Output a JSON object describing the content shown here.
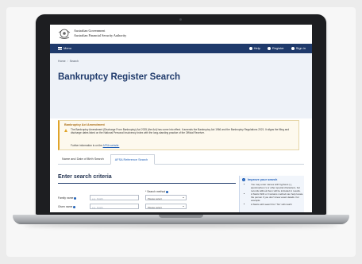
{
  "gov": {
    "line1": "Australian Government",
    "line2": "Australian Financial Security Authority"
  },
  "nav": {
    "menu_label": "Menu",
    "help_label": "Help",
    "register_label": "Register",
    "signin_label": "Sign in"
  },
  "breadcrumb": {
    "home": "Home",
    "current": "Search"
  },
  "page_title": "Bankruptcy Register Search",
  "notice": {
    "title": "Bankruptcy Act Amendment",
    "body": "The Bankruptcy Amendment (Discharge From Bankruptcy) Act 2025 (the Act) has come into effect. It amends the Bankruptcy Act 1966 and the Bankruptcy Regulations 2021. It aligns the filing and discharge dates listed on the National Personal Insolvency Index with the long-standing practice of the Official Receiver.",
    "more_prefix": "Further information is on the",
    "more_link": "AFSA website."
  },
  "tabs": [
    "Name and Date of Birth Search",
    "AFSA Reference Search"
  ],
  "criteria": {
    "title": "Enter search criteria",
    "search_method_label": "* Search method",
    "family_name_label": "Family name",
    "given_name_label": "Given name",
    "placeholder": "e.g. Smith",
    "select_placeholder": "Please select"
  },
  "help": {
    "title": "Improve your search",
    "items": [
      "You may enter names with hyphens (-), apostrophes (') or other special characters, but records without them will be included in results.",
      "A Starts With or Contains method can help locate the person if you don't know exact details. For example:",
      "A Starts with search for 'Tim' will match"
    ]
  },
  "colors": {
    "navy": "#1f3a6b",
    "accent_blue": "#1f5fb8",
    "warning": "#e0a42a"
  }
}
